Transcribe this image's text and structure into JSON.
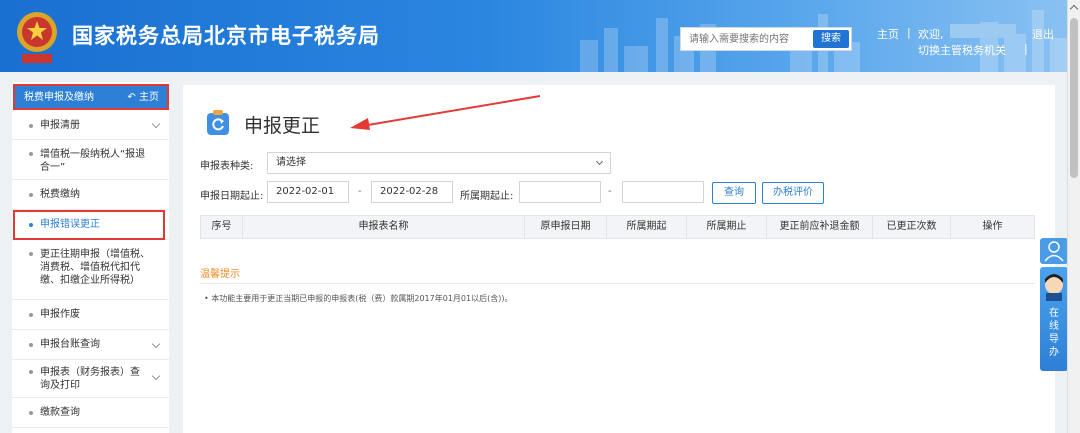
{
  "header": {
    "site_title": "国家税务总局北京市电子税务局",
    "search_placeholder": "请输入需要搜索的内容",
    "search_button": "搜索",
    "home": "主页",
    "separator": "|",
    "welcome": "欢迎,",
    "switch_authority": "切换主管税务机关",
    "logout": "退出"
  },
  "sidebar": {
    "head_label": "税费申报及缴纳",
    "head_home": "主页",
    "items": [
      {
        "label": "申报清册"
      },
      {
        "label": "增值税一般纳税人“报退合一”"
      },
      {
        "label": "税费缴纳"
      },
      {
        "label": "申报错误更正"
      },
      {
        "label": "更正往期申报（增值税、消费税、增值税代扣代缴、扣缴企业所得税）"
      },
      {
        "label": "申报作废"
      },
      {
        "label": "申报台账查询"
      },
      {
        "label": "申报表（财务报表）查询及打印"
      },
      {
        "label": "缴款查询"
      }
    ]
  },
  "main": {
    "page_title": "申报更正",
    "form": {
      "type_label": "申报表种类:",
      "type_value": "请选择",
      "date_label": "申报日期起止:",
      "date_start": "2022-02-01",
      "date_end": "2022-02-28",
      "period_label": "所属期起止:",
      "period_start": "",
      "period_end": "",
      "dash": "-",
      "query_button": "查询",
      "evaluate_button": "办税评价"
    },
    "table_headers": [
      "序号",
      "申报表名称",
      "原申报日期",
      "所属期起",
      "所属期止",
      "更正前应补退金额",
      "已更正次数",
      "操作"
    ],
    "tips_title": "温馨提示",
    "tips_text": "• 本功能主要用于更正当期已申报的申报表(税（费）款属期2017年01月01以后(含))。"
  },
  "float_widget": {
    "label_chars": [
      "在",
      "线",
      "导",
      "办"
    ]
  },
  "colors": {
    "header_blue": "#1a6fd0",
    "accent": "#2e7fd6",
    "annotation_red": "#e53935",
    "tips_orange": "#f08a24"
  },
  "icons": [
    "emblem-icon",
    "home-arrow-icon",
    "chevron-down-icon",
    "refresh-clipboard-icon",
    "user-icon",
    "service-avatar-icon"
  ]
}
